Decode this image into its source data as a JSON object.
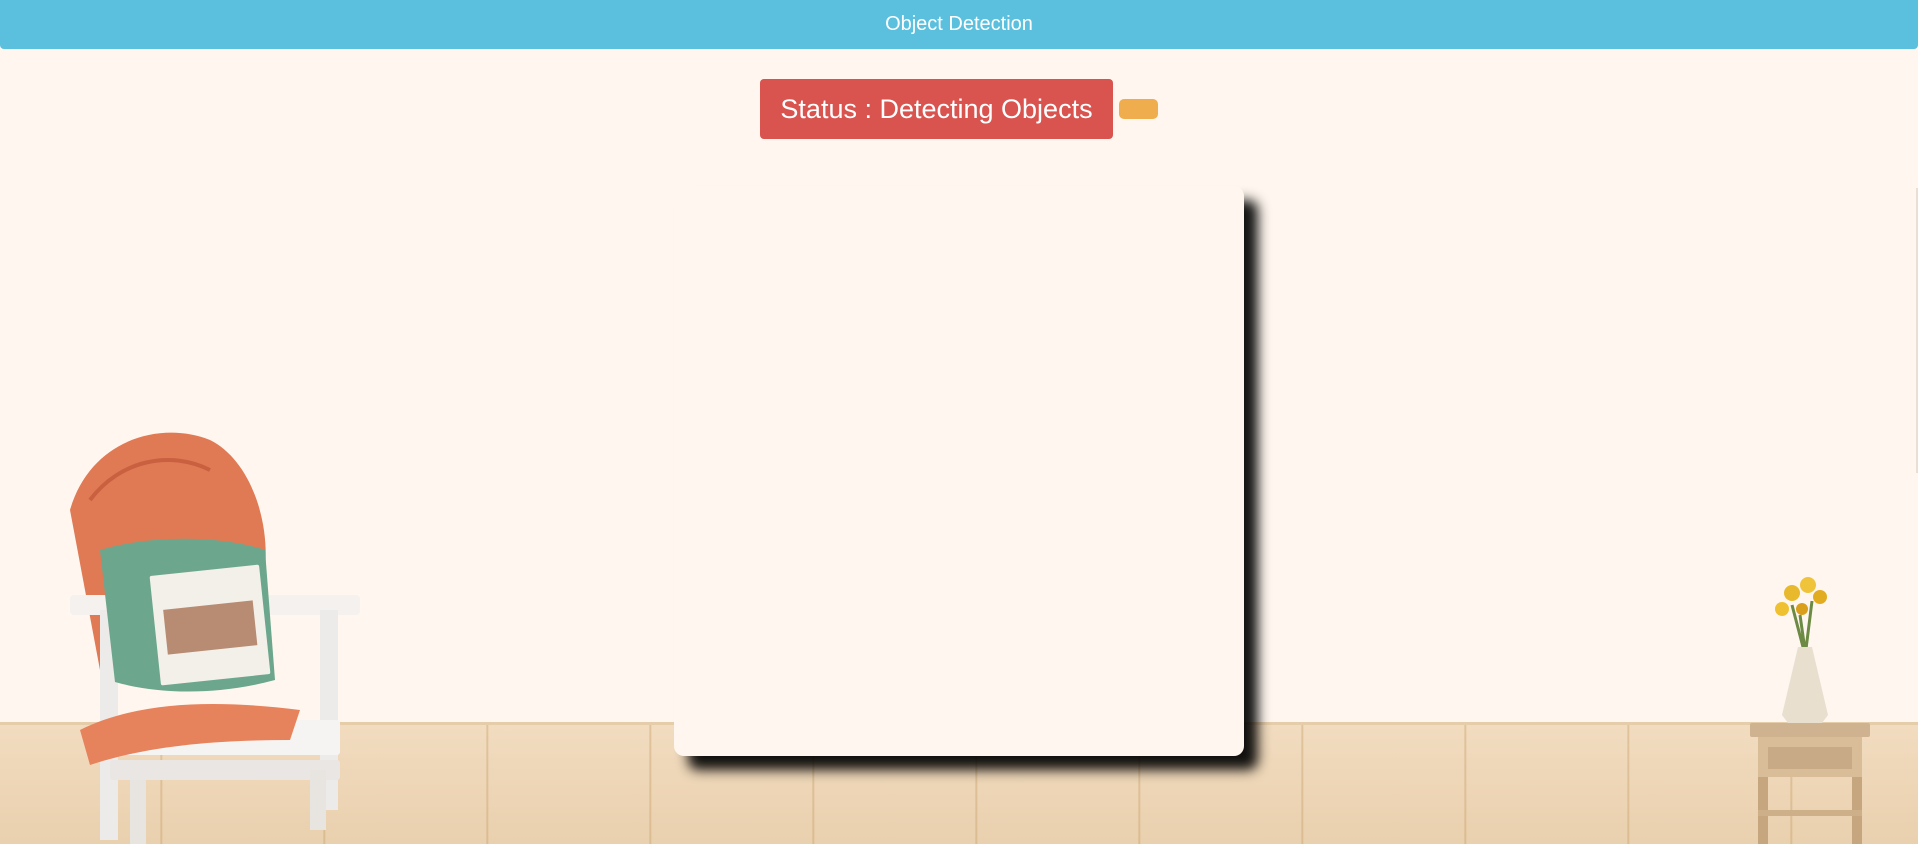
{
  "header": {
    "title": "Object Detection"
  },
  "status": {
    "label": "Status : Detecting Objects"
  },
  "colors": {
    "navbar": "#5bc0de",
    "status_label": "#d9534f",
    "status_indicator": "#f0ad4e",
    "background": "#fff7ef"
  },
  "icons": [
    "chair-decor-image",
    "flower-table-decor-image"
  ]
}
